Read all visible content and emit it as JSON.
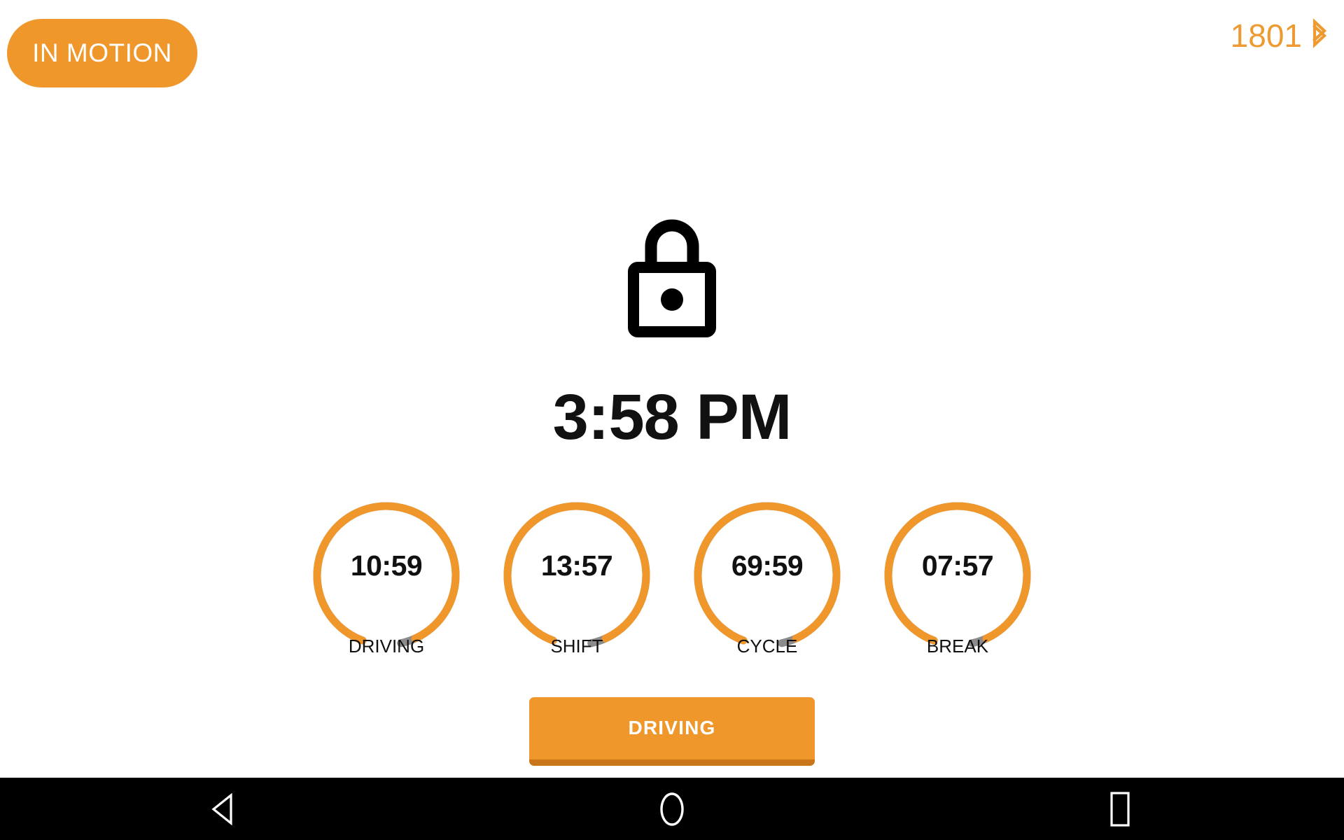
{
  "app": {
    "background_color": "#ffffff",
    "accent_color": "#F0972C",
    "accent_dark_color": "#C9761A",
    "muted_color": "#8C8C8C",
    "text_color": "#111111"
  },
  "status_bar": {
    "motion_badge": {
      "label": "IN MOTION",
      "icon": "motion-badge",
      "background_color": "#F0972C",
      "text_color": "#ffffff"
    },
    "device": {
      "id": "1801",
      "bluetooth_icon": "bluetooth-icon",
      "color": "#EE9A33"
    }
  },
  "lock_screen": {
    "lock_icon": "lock-icon",
    "time": "3:58 PM"
  },
  "timers": [
    {
      "value": "10:59",
      "label": "DRIVING",
      "progress_percent": 93,
      "arc_color": "#F0972C",
      "remainder_color": "#8C8C8C"
    },
    {
      "value": "13:57",
      "label": "SHIFT",
      "progress_percent": 93,
      "arc_color": "#F0972C",
      "remainder_color": "#8C8C8C"
    },
    {
      "value": "69:59",
      "label": "CYCLE",
      "progress_percent": 93,
      "arc_color": "#F0972C",
      "remainder_color": "#8C8C8C"
    },
    {
      "value": "07:57",
      "label": "BREAK",
      "progress_percent": 93,
      "arc_color": "#F0972C",
      "remainder_color": "#8C8C8C"
    }
  ],
  "duty_status": {
    "label": "DRIVING",
    "background_color": "#F0972C",
    "edge_color": "#C9761A",
    "text_color": "#ffffff"
  },
  "navigation_bar": {
    "background_color": "#000000",
    "buttons": [
      {
        "name": "back",
        "icon": "back-triangle-icon"
      },
      {
        "name": "home",
        "icon": "home-circle-icon"
      },
      {
        "name": "recents",
        "icon": "recents-square-icon"
      }
    ]
  }
}
